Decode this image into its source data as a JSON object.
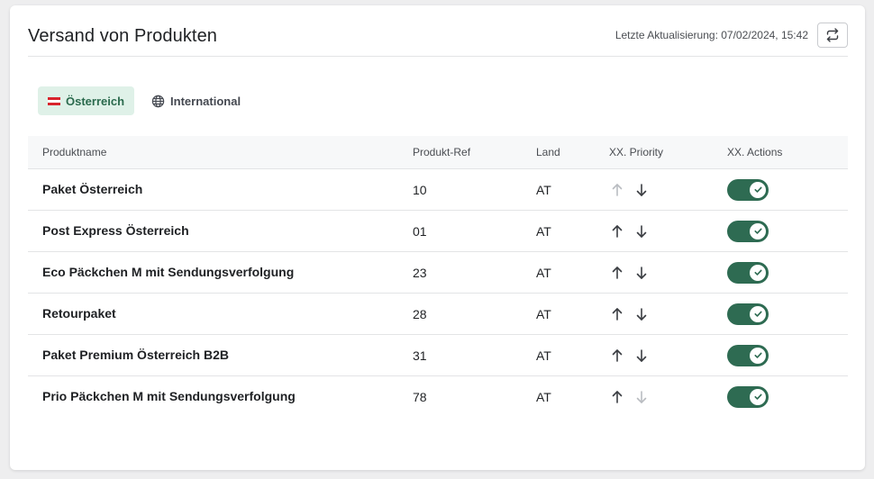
{
  "header": {
    "title": "Versand von Produkten",
    "last_updated": "Letzte Aktualisierung: 07/02/2024, 15:42",
    "refresh_icon": "refresh-icon"
  },
  "tabs": [
    {
      "label": "Österreich",
      "icon": "austria-flag-icon",
      "active": true
    },
    {
      "label": "International",
      "icon": "globe-icon",
      "active": false
    }
  ],
  "table": {
    "columns": [
      "Produktname",
      "Produkt-Ref",
      "Land",
      "XX. Priority",
      "XX. Actions"
    ],
    "rows": [
      {
        "name": "Paket Österreich",
        "ref": "10",
        "country": "AT",
        "up_enabled": false,
        "down_enabled": true,
        "active": true
      },
      {
        "name": "Post Express Österreich",
        "ref": "01",
        "country": "AT",
        "up_enabled": true,
        "down_enabled": true,
        "active": true
      },
      {
        "name": "Eco Päckchen M mit Sendungsverfolgung",
        "ref": "23",
        "country": "AT",
        "up_enabled": true,
        "down_enabled": true,
        "active": true
      },
      {
        "name": "Retourpaket",
        "ref": "28",
        "country": "AT",
        "up_enabled": true,
        "down_enabled": true,
        "active": true
      },
      {
        "name": "Paket Premium Österreich B2B",
        "ref": "31",
        "country": "AT",
        "up_enabled": true,
        "down_enabled": true,
        "active": true
      },
      {
        "name": "Prio Päckchen M mit Sendungsverfolgung",
        "ref": "78",
        "country": "AT",
        "up_enabled": true,
        "down_enabled": false,
        "active": true
      }
    ]
  },
  "colors": {
    "accent": "#2e6b52",
    "tab_active_bg": "#dff1e8",
    "arrow_enabled": "#3a3d42",
    "arrow_disabled": "#b9bcc1"
  }
}
